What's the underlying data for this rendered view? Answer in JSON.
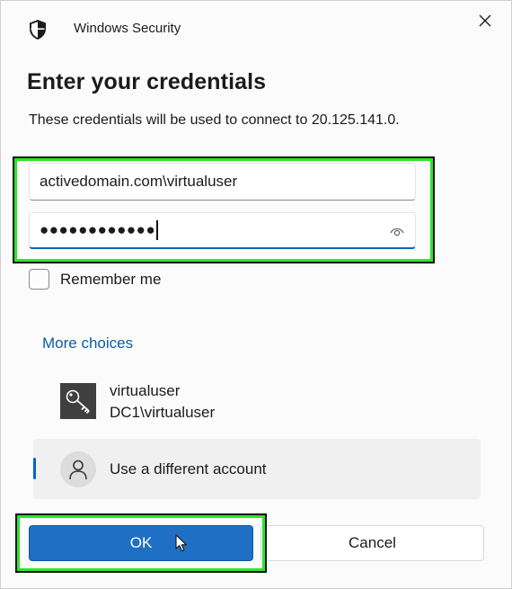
{
  "window": {
    "title": "Windows Security",
    "close_glyph": "✕"
  },
  "dialog": {
    "heading": "Enter your credentials",
    "description": "These credentials will be used to connect to 20.125.141.0."
  },
  "fields": {
    "username_value": "activedomain.com\\virtualuser",
    "password_masked": "●●●●●●●●●●●●"
  },
  "remember": {
    "label": "Remember me",
    "checked": false
  },
  "more_choices": {
    "label": "More choices"
  },
  "accounts": [
    {
      "name": "virtualuser",
      "sub": "DC1\\virtualuser",
      "icon": "key-icon"
    },
    {
      "name": "Use a different account",
      "icon": "user-icon",
      "selected": true
    }
  ],
  "buttons": {
    "ok_label": "OK",
    "cancel_label": "Cancel"
  },
  "colors": {
    "accent": "#1f6fc5",
    "link": "#0b5ca8",
    "highlight": "#2ee52a"
  }
}
